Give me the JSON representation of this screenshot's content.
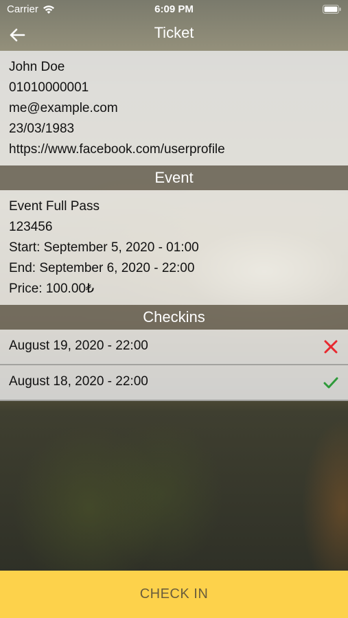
{
  "status_bar": {
    "carrier": "Carrier",
    "time": "6:09 PM"
  },
  "nav": {
    "title": "Ticket"
  },
  "attendee": {
    "name": "John Doe",
    "phone": "01010000001",
    "email": "me@example.com",
    "birthdate": "23/03/1983",
    "profile_url": "https://www.facebook.com/userprofile"
  },
  "event_section": {
    "header": "Event",
    "ticket_type": "Event Full Pass",
    "code": "123456",
    "start": "Start: September 5, 2020 - 01:00",
    "end": "End: September 6, 2020 - 22:00",
    "price": "Price: 100.00₺"
  },
  "checkins_section": {
    "header": "Checkins",
    "items": [
      {
        "date": "August 19, 2020 - 22:00",
        "status": "failed",
        "icon": "x-icon",
        "color": "#e8282f"
      },
      {
        "date": "August 18, 2020 - 22:00",
        "status": "success",
        "icon": "checkmark-icon",
        "color": "#2e9a3a"
      }
    ]
  },
  "actions": {
    "check_in_label": "CHECK IN",
    "check_in_color": "#fdd24b"
  }
}
